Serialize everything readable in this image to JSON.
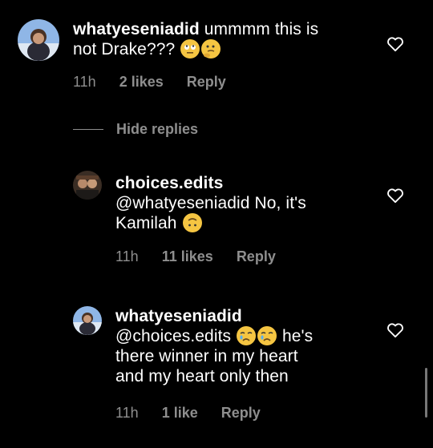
{
  "comments": [
    {
      "username": "whatyeseniadid",
      "text_line1": "ummmm this is",
      "text_line2": "not Drake???",
      "time": "11h",
      "likes": "2 likes",
      "reply": "Reply",
      "emojis": [
        "thinking-face-rolling-eyes",
        "thinking-face"
      ]
    },
    {
      "username": "choices.edits",
      "text_line1": "@whatyeseniadid No, it's",
      "text_line2": "Kamilah",
      "time": "11h",
      "likes": "11 likes",
      "reply": "Reply",
      "emojis": [
        "upside-down-face"
      ]
    },
    {
      "username": "whatyeseniadid",
      "text_mention": "@choices.edits",
      "text_after_emoji": "he's",
      "text_line2": "there winner in my heart",
      "text_line3": "and my heart only then",
      "time": "11h",
      "likes": "1 like",
      "reply": "Reply",
      "emojis": [
        "crying-face",
        "crying-face"
      ]
    }
  ],
  "hide_replies": "Hide replies",
  "colors": {
    "background": "#000000",
    "text": "#ffffff",
    "muted": "#8e8e8e",
    "emoji": "#f5c542"
  }
}
